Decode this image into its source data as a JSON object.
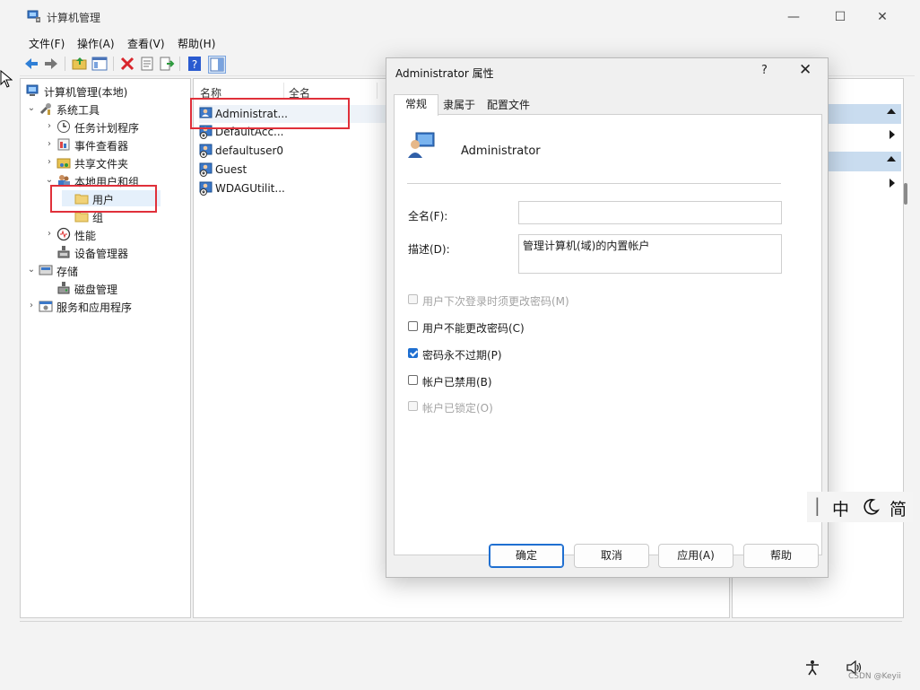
{
  "window": {
    "title": "计算机管理",
    "controls": {
      "minimize": "—",
      "maximize": "☐",
      "close": "✕"
    }
  },
  "menu": [
    "文件(F)",
    "操作(A)",
    "查看(V)",
    "帮助(H)"
  ],
  "tree": [
    {
      "label": "计算机管理(本地)",
      "arrow": "",
      "icon": "computer-icon"
    },
    {
      "label": "系统工具",
      "arrow": "⌄",
      "icon": "tools-icon"
    },
    {
      "label": "任务计划程序",
      "arrow": "›",
      "icon": "clock-icon"
    },
    {
      "label": "事件查看器",
      "arrow": "›",
      "icon": "event-viewer-icon"
    },
    {
      "label": "共享文件夹",
      "arrow": "›",
      "icon": "shared-folder-icon"
    },
    {
      "label": "本地用户和组",
      "arrow": "⌄",
      "icon": "users-group-icon"
    },
    {
      "label": "用户",
      "arrow": "",
      "icon": "folder-icon"
    },
    {
      "label": "组",
      "arrow": "",
      "icon": "folder-icon"
    },
    {
      "label": "性能",
      "arrow": "›",
      "icon": "performance-icon"
    },
    {
      "label": "设备管理器",
      "arrow": "",
      "icon": "device-manager-icon"
    },
    {
      "label": "存储",
      "arrow": "⌄",
      "icon": "storage-icon"
    },
    {
      "label": "磁盘管理",
      "arrow": "",
      "icon": "disk-icon"
    },
    {
      "label": "服务和应用程序",
      "arrow": "›",
      "icon": "services-icon"
    }
  ],
  "list": {
    "columns": [
      "名称",
      "全名"
    ],
    "rows": [
      {
        "name": "Administrat...",
        "icon": "user-icon"
      },
      {
        "name": "DefaultAcc...",
        "icon": "user-disabled-icon"
      },
      {
        "name": "defaultuser0",
        "icon": "user-disabled-icon"
      },
      {
        "name": "Guest",
        "icon": "user-disabled-icon"
      },
      {
        "name": "WDAGUtilit...",
        "icon": "user-disabled-icon"
      }
    ]
  },
  "dialog": {
    "title": "Administrator 属性",
    "help": "?",
    "close": "✕",
    "tabs": [
      "常规",
      "隶属于",
      "配置文件"
    ],
    "user_name": "Administrator",
    "fullname_label": "全名(F):",
    "fullname_value": "",
    "description_label": "描述(D):",
    "description_value": "管理计算机(域)的内置帐户",
    "checkboxes": [
      {
        "label": "用户下次登录时须更改密码(M)",
        "checked": false,
        "disabled": true
      },
      {
        "label": "用户不能更改密码(C)",
        "checked": false,
        "disabled": false
      },
      {
        "label": "密码永不过期(P)",
        "checked": true,
        "disabled": false
      },
      {
        "label": "帐户已禁用(B)",
        "checked": false,
        "disabled": false
      },
      {
        "label": "帐户已锁定(O)",
        "checked": false,
        "disabled": true
      }
    ],
    "buttons": {
      "ok": "确定",
      "cancel": "取消",
      "apply": "应用(A)",
      "help": "帮助"
    }
  },
  "ime": {
    "lang": "中",
    "mode": "简"
  },
  "watermark": "CSDN @Keyii",
  "colors": {
    "accent": "#1f6fd1",
    "annotation": "#e0303a",
    "actions_header": "#c9dcef"
  }
}
